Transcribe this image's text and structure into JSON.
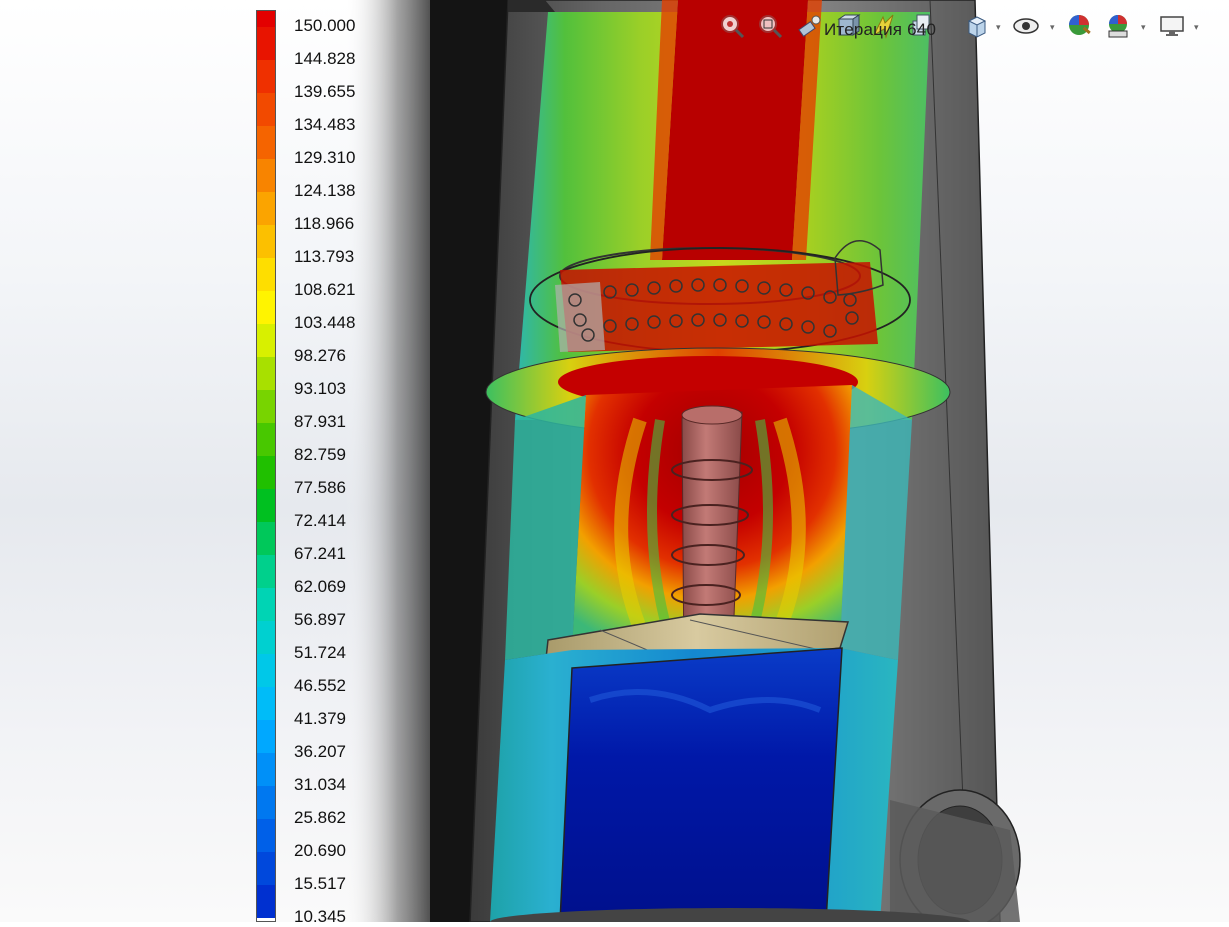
{
  "app": {
    "viewport_label": "Temperature cut plot of cylindrical device"
  },
  "legend": {
    "labels": [
      "150.000",
      "144.828",
      "139.655",
      "134.483",
      "129.310",
      "124.138",
      "118.966",
      "113.793",
      "108.621",
      "103.448",
      "98.276",
      "93.103",
      "87.931",
      "82.759",
      "77.586",
      "72.414",
      "67.241",
      "62.069",
      "56.897",
      "51.724",
      "46.552",
      "41.379",
      "36.207",
      "31.034",
      "25.862",
      "20.690",
      "15.517",
      "10.345"
    ],
    "colors": [
      "#e30000",
      "#e81400",
      "#ef3000",
      "#f24a00",
      "#f56400",
      "#f88400",
      "#fba400",
      "#fcc000",
      "#fede00",
      "#fff400",
      "#d8f000",
      "#a8e000",
      "#78d400",
      "#48c800",
      "#20c000",
      "#00c020",
      "#00c85a",
      "#00d08c",
      "#00d4b4",
      "#00d0d0",
      "#00c8e8",
      "#00bcf8",
      "#00a8ff",
      "#0090f8",
      "#0078f0",
      "#0060e8",
      "#0048dc",
      "#0030d0"
    ]
  },
  "status": {
    "text": "Итерация 640"
  },
  "toolbar": {
    "items": [
      {
        "name": "zoom-to-fit-icon"
      },
      {
        "name": "zoom-to-area-icon"
      },
      {
        "name": "previous-view-icon"
      },
      {
        "name": "section-view-icon"
      },
      {
        "name": "dynamic-annotation-icon"
      },
      {
        "name": "display-style-icon"
      },
      {
        "name": "view-orientation-icon"
      },
      {
        "name": "hide-show-items-icon"
      },
      {
        "name": "edit-appearance-icon"
      },
      {
        "name": "apply-scene-icon"
      },
      {
        "name": "view-settings-icon"
      }
    ]
  }
}
